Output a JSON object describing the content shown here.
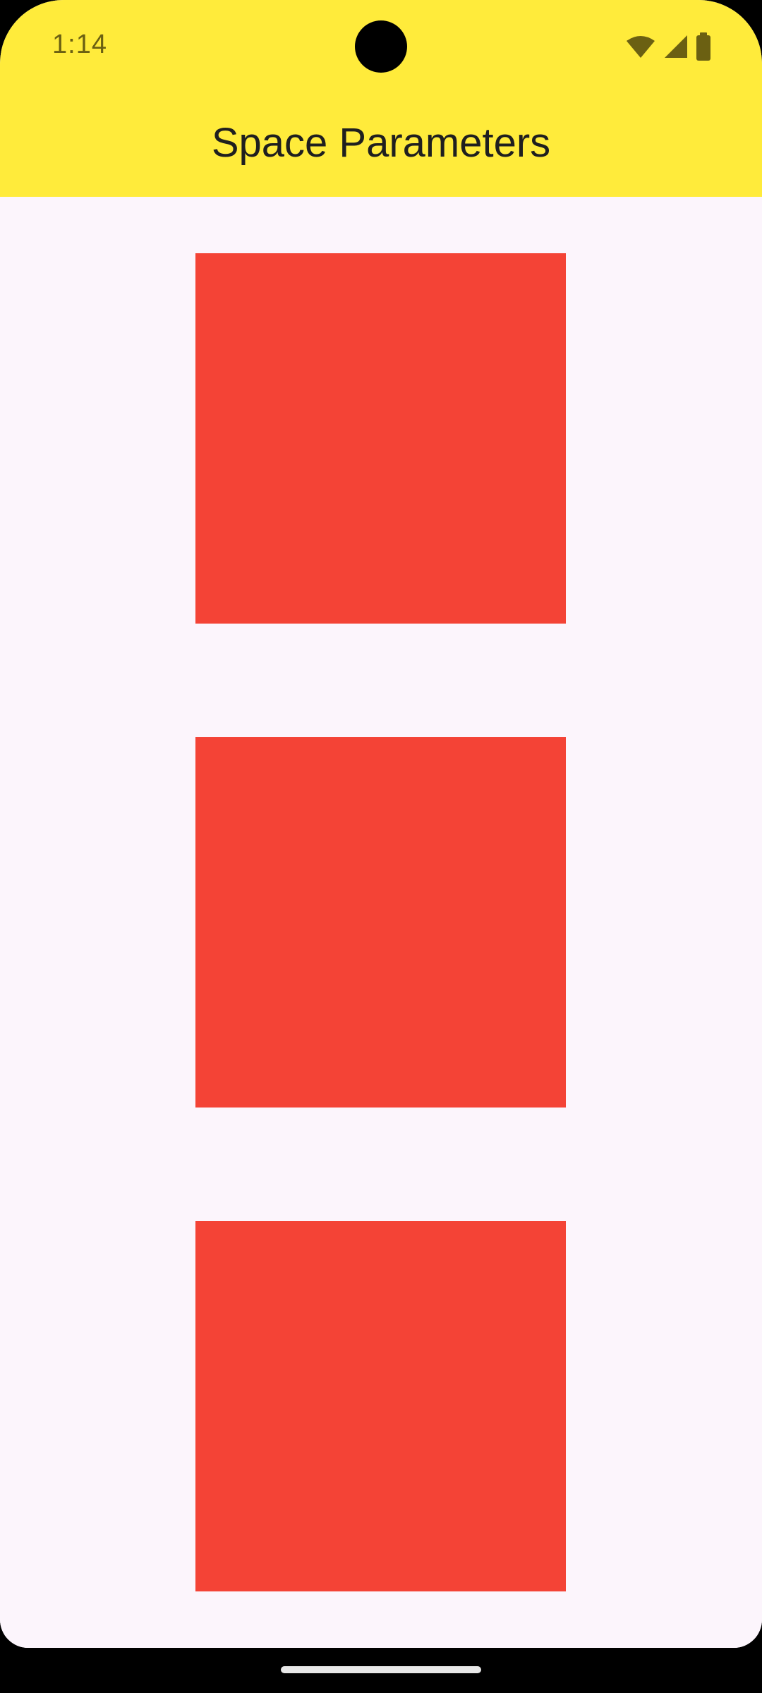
{
  "status_bar": {
    "time": "1:14",
    "icons": [
      "wifi-icon",
      "cellular-signal-icon",
      "battery-icon"
    ],
    "icon_color": "#6b6012"
  },
  "app_bar": {
    "title": "Space Parameters",
    "background_color": "#ffeb3b"
  },
  "content": {
    "background_color": "#fcf5fc",
    "boxes": [
      {
        "color": "#f44336"
      },
      {
        "color": "#f44336"
      },
      {
        "color": "#f44336"
      }
    ]
  },
  "navigation": {
    "gesture_handle": true
  }
}
